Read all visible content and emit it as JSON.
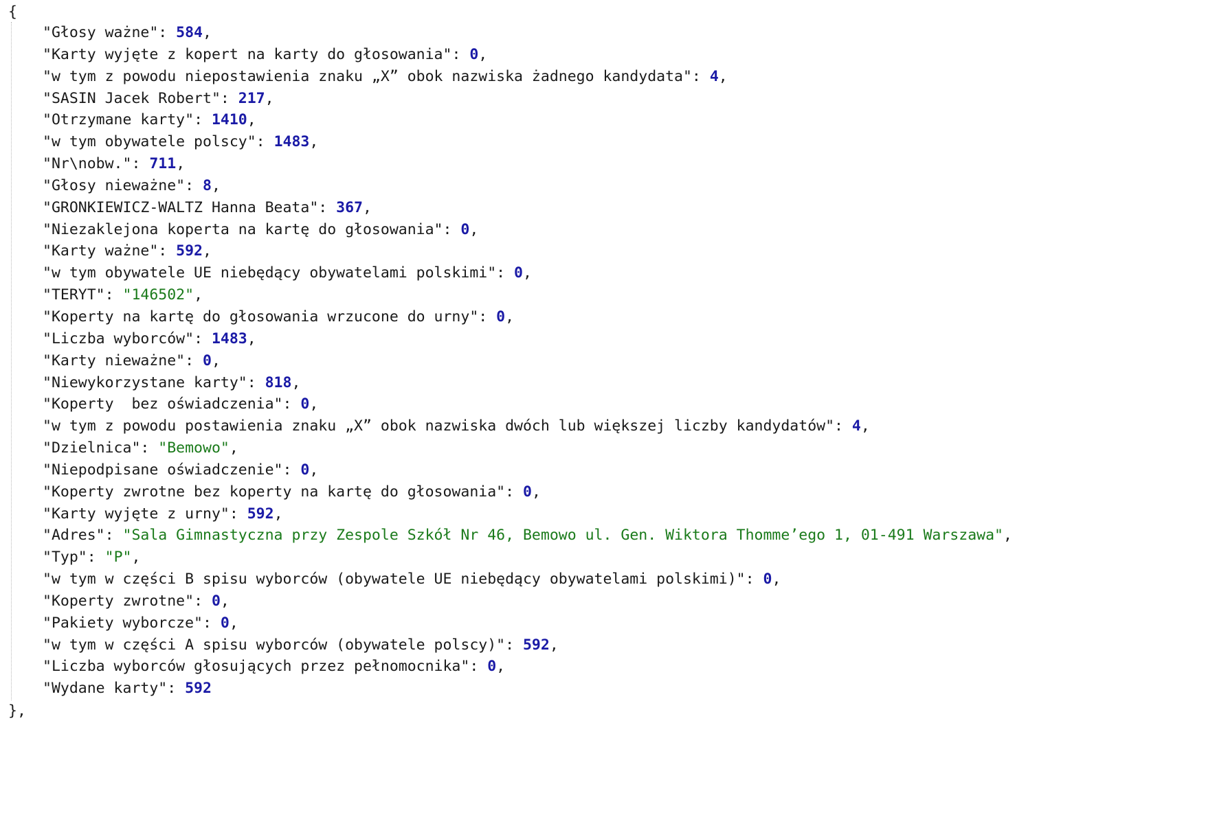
{
  "open_brace": "{",
  "close_brace": "},",
  "entries": [
    {
      "key": "\"Głosy ważne\"",
      "sep": ": ",
      "value": "584",
      "type": "num",
      "comma": ","
    },
    {
      "key": "\"Karty wyjęte z kopert na karty do głosowania\"",
      "sep": ": ",
      "value": "0",
      "type": "num",
      "comma": ","
    },
    {
      "key": "\"w tym z powodu niepostawienia znaku „X” obok nazwiska żadnego kandydata\"",
      "sep": ": ",
      "value": "4",
      "type": "num",
      "comma": ","
    },
    {
      "key": "\"SASIN Jacek Robert\"",
      "sep": ": ",
      "value": "217",
      "type": "num",
      "comma": ","
    },
    {
      "key": "\"Otrzymane karty\"",
      "sep": ": ",
      "value": "1410",
      "type": "num",
      "comma": ","
    },
    {
      "key": "\"w tym obywatele polscy\"",
      "sep": ": ",
      "value": "1483",
      "type": "num",
      "comma": ","
    },
    {
      "key": "\"Nr\\nobw.\"",
      "sep": ": ",
      "value": "711",
      "type": "num",
      "comma": ","
    },
    {
      "key": "\"Głosy nieważne\"",
      "sep": ": ",
      "value": "8",
      "type": "num",
      "comma": ","
    },
    {
      "key": "\"GRONKIEWICZ-WALTZ Hanna Beata\"",
      "sep": ": ",
      "value": "367",
      "type": "num",
      "comma": ","
    },
    {
      "key": "\"Niezaklejona koperta na kartę do głosowania\"",
      "sep": ": ",
      "value": "0",
      "type": "num",
      "comma": ","
    },
    {
      "key": "\"Karty ważne\"",
      "sep": ": ",
      "value": "592",
      "type": "num",
      "comma": ","
    },
    {
      "key": "\"w tym obywatele UE niebędący obywatelami polskimi\"",
      "sep": ": ",
      "value": "0",
      "type": "num",
      "comma": ","
    },
    {
      "key": "\"TERYT\"",
      "sep": ": ",
      "value": "\"146502\"",
      "type": "str",
      "comma": ","
    },
    {
      "key": "\"Koperty na kartę do głosowania wrzucone do urny\"",
      "sep": ": ",
      "value": "0",
      "type": "num",
      "comma": ","
    },
    {
      "key": "\"Liczba wyborców\"",
      "sep": ": ",
      "value": "1483",
      "type": "num",
      "comma": ","
    },
    {
      "key": "\"Karty nieważne\"",
      "sep": ": ",
      "value": "0",
      "type": "num",
      "comma": ","
    },
    {
      "key": "\"Niewykorzystane karty\"",
      "sep": ": ",
      "value": "818",
      "type": "num",
      "comma": ","
    },
    {
      "key": "\"Koperty  bez oświadczenia\"",
      "sep": ": ",
      "value": "0",
      "type": "num",
      "comma": ","
    },
    {
      "key": "\"w tym z powodu postawienia znaku „X” obok nazwiska dwóch lub większej liczby kandydatów\"",
      "sep": ": ",
      "value": "4",
      "type": "num",
      "comma": ","
    },
    {
      "key": "\"Dzielnica\"",
      "sep": ": ",
      "value": "\"Bemowo\"",
      "type": "str",
      "comma": ","
    },
    {
      "key": "\"Niepodpisane oświadczenie\"",
      "sep": ": ",
      "value": "0",
      "type": "num",
      "comma": ","
    },
    {
      "key": "\"Koperty zwrotne bez koperty na kartę do głosowania\"",
      "sep": ": ",
      "value": "0",
      "type": "num",
      "comma": ","
    },
    {
      "key": "\"Karty wyjęte z urny\"",
      "sep": ": ",
      "value": "592",
      "type": "num",
      "comma": ","
    },
    {
      "key": "\"Adres\"",
      "sep": ": ",
      "value": "\"Sala Gimnastyczna przy Zespole Szkół Nr 46, Bemowo ul. Gen. Wiktora Thomme’ego 1, 01-491 Warszawa\"",
      "type": "str",
      "comma": ","
    },
    {
      "key": "\"Typ\"",
      "sep": ": ",
      "value": "\"P\"",
      "type": "str",
      "comma": ","
    },
    {
      "key": "\"w tym w części B spisu wyborców (obywatele UE niebędący obywatelami polskimi)\"",
      "sep": ": ",
      "value": "0",
      "type": "num",
      "comma": ","
    },
    {
      "key": "\"Koperty zwrotne\"",
      "sep": ": ",
      "value": "0",
      "type": "num",
      "comma": ","
    },
    {
      "key": "\"Pakiety wyborcze\"",
      "sep": ": ",
      "value": "0",
      "type": "num",
      "comma": ","
    },
    {
      "key": "\"w tym w części A spisu wyborców (obywatele polscy)\"",
      "sep": ": ",
      "value": "592",
      "type": "num",
      "comma": ","
    },
    {
      "key": "\"Liczba wyborców głosujących przez pełnomocnika\"",
      "sep": ": ",
      "value": "0",
      "type": "num",
      "comma": ","
    },
    {
      "key": "\"Wydane karty\"",
      "sep": ": ",
      "value": "592",
      "type": "num",
      "comma": ""
    }
  ]
}
